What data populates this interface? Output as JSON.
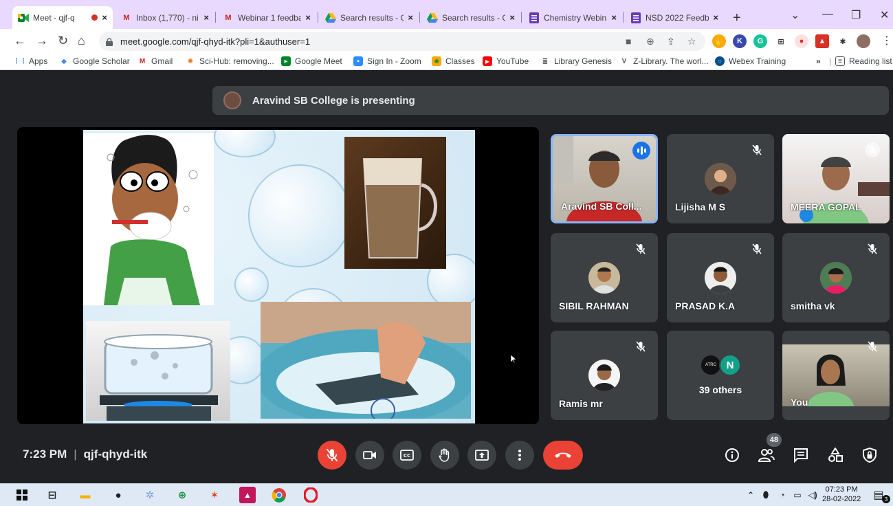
{
  "browser": {
    "tabs": [
      {
        "label": "Meet - qjf-q",
        "icon": "meet-icon",
        "active": true,
        "recording": true
      },
      {
        "label": "Inbox (1,770) - ni",
        "icon": "gmail-icon"
      },
      {
        "label": "Webinar 1 feedba",
        "icon": "gmail-icon"
      },
      {
        "label": "Search results - G",
        "icon": "drive-icon"
      },
      {
        "label": "Search results - G",
        "icon": "drive-icon"
      },
      {
        "label": "Chemistry Webin",
        "icon": "forms-icon"
      },
      {
        "label": "NSD 2022 Feedb",
        "icon": "forms-icon"
      }
    ],
    "url": "meet.google.com/qjf-qhyd-itk?pli=1&authuser=1",
    "bookmarks": [
      {
        "label": "Apps",
        "icon": "apps-grid-icon"
      },
      {
        "label": "Google Scholar",
        "icon": "scholar-icon"
      },
      {
        "label": "Gmail",
        "icon": "gmail-icon"
      },
      {
        "label": "Sci-Hub: removing...",
        "icon": "scihub-icon"
      },
      {
        "label": "Google Meet",
        "icon": "meet-icon"
      },
      {
        "label": "Sign In - Zoom",
        "icon": "zoom-icon"
      },
      {
        "label": "Classes",
        "icon": "classroom-icon"
      },
      {
        "label": "YouTube",
        "icon": "youtube-icon"
      },
      {
        "label": "Library Genesis",
        "icon": "libgen-icon"
      },
      {
        "label": "Z-Library. The worl...",
        "icon": "zlibrary-icon"
      },
      {
        "label": "Webex Training",
        "icon": "webex-icon"
      }
    ],
    "bookmarks_more": "»",
    "reading_list": "Reading list"
  },
  "meet": {
    "presenting_banner": "Aravind SB College is presenting",
    "time": "7:23 PM",
    "meeting_code": "qjf-qhyd-itk",
    "participant_count": "48",
    "tiles": [
      {
        "name": "Aravind SB Coll...",
        "speaking": true,
        "muted": false,
        "video": true
      },
      {
        "name": "Lijisha M S",
        "muted": true,
        "video": false
      },
      {
        "name": "MEERA GOPAL",
        "muted": true,
        "video": true
      },
      {
        "name": "SIBIL RAHMAN",
        "muted": true,
        "video": false
      },
      {
        "name": "PRASAD K.A",
        "muted": true,
        "video": false
      },
      {
        "name": "smitha vk",
        "muted": true,
        "video": false
      },
      {
        "name": "Ramis mr",
        "muted": true,
        "video": false
      },
      {
        "name": "39 others",
        "others_initial": "N",
        "others_badge": "ATRC"
      },
      {
        "name": "You",
        "muted": true,
        "video": true
      }
    ],
    "controls": [
      "mic-off-icon",
      "camera-icon",
      "captions-icon",
      "raise-hand-icon",
      "present-icon",
      "more-options-icon",
      "end-call-icon"
    ],
    "right_controls": [
      "info-icon",
      "people-icon",
      "chat-icon",
      "activities-icon",
      "host-controls-icon"
    ]
  },
  "taskbar": {
    "time": "07:23 PM",
    "date": "28-02-2022",
    "notifications": "3"
  },
  "colors": {
    "meet_bg": "#202124",
    "tile_bg": "#3c4043",
    "red": "#ea4335",
    "speaking_border": "#8ab4f8",
    "tabstrip": "#e9d9ff"
  }
}
